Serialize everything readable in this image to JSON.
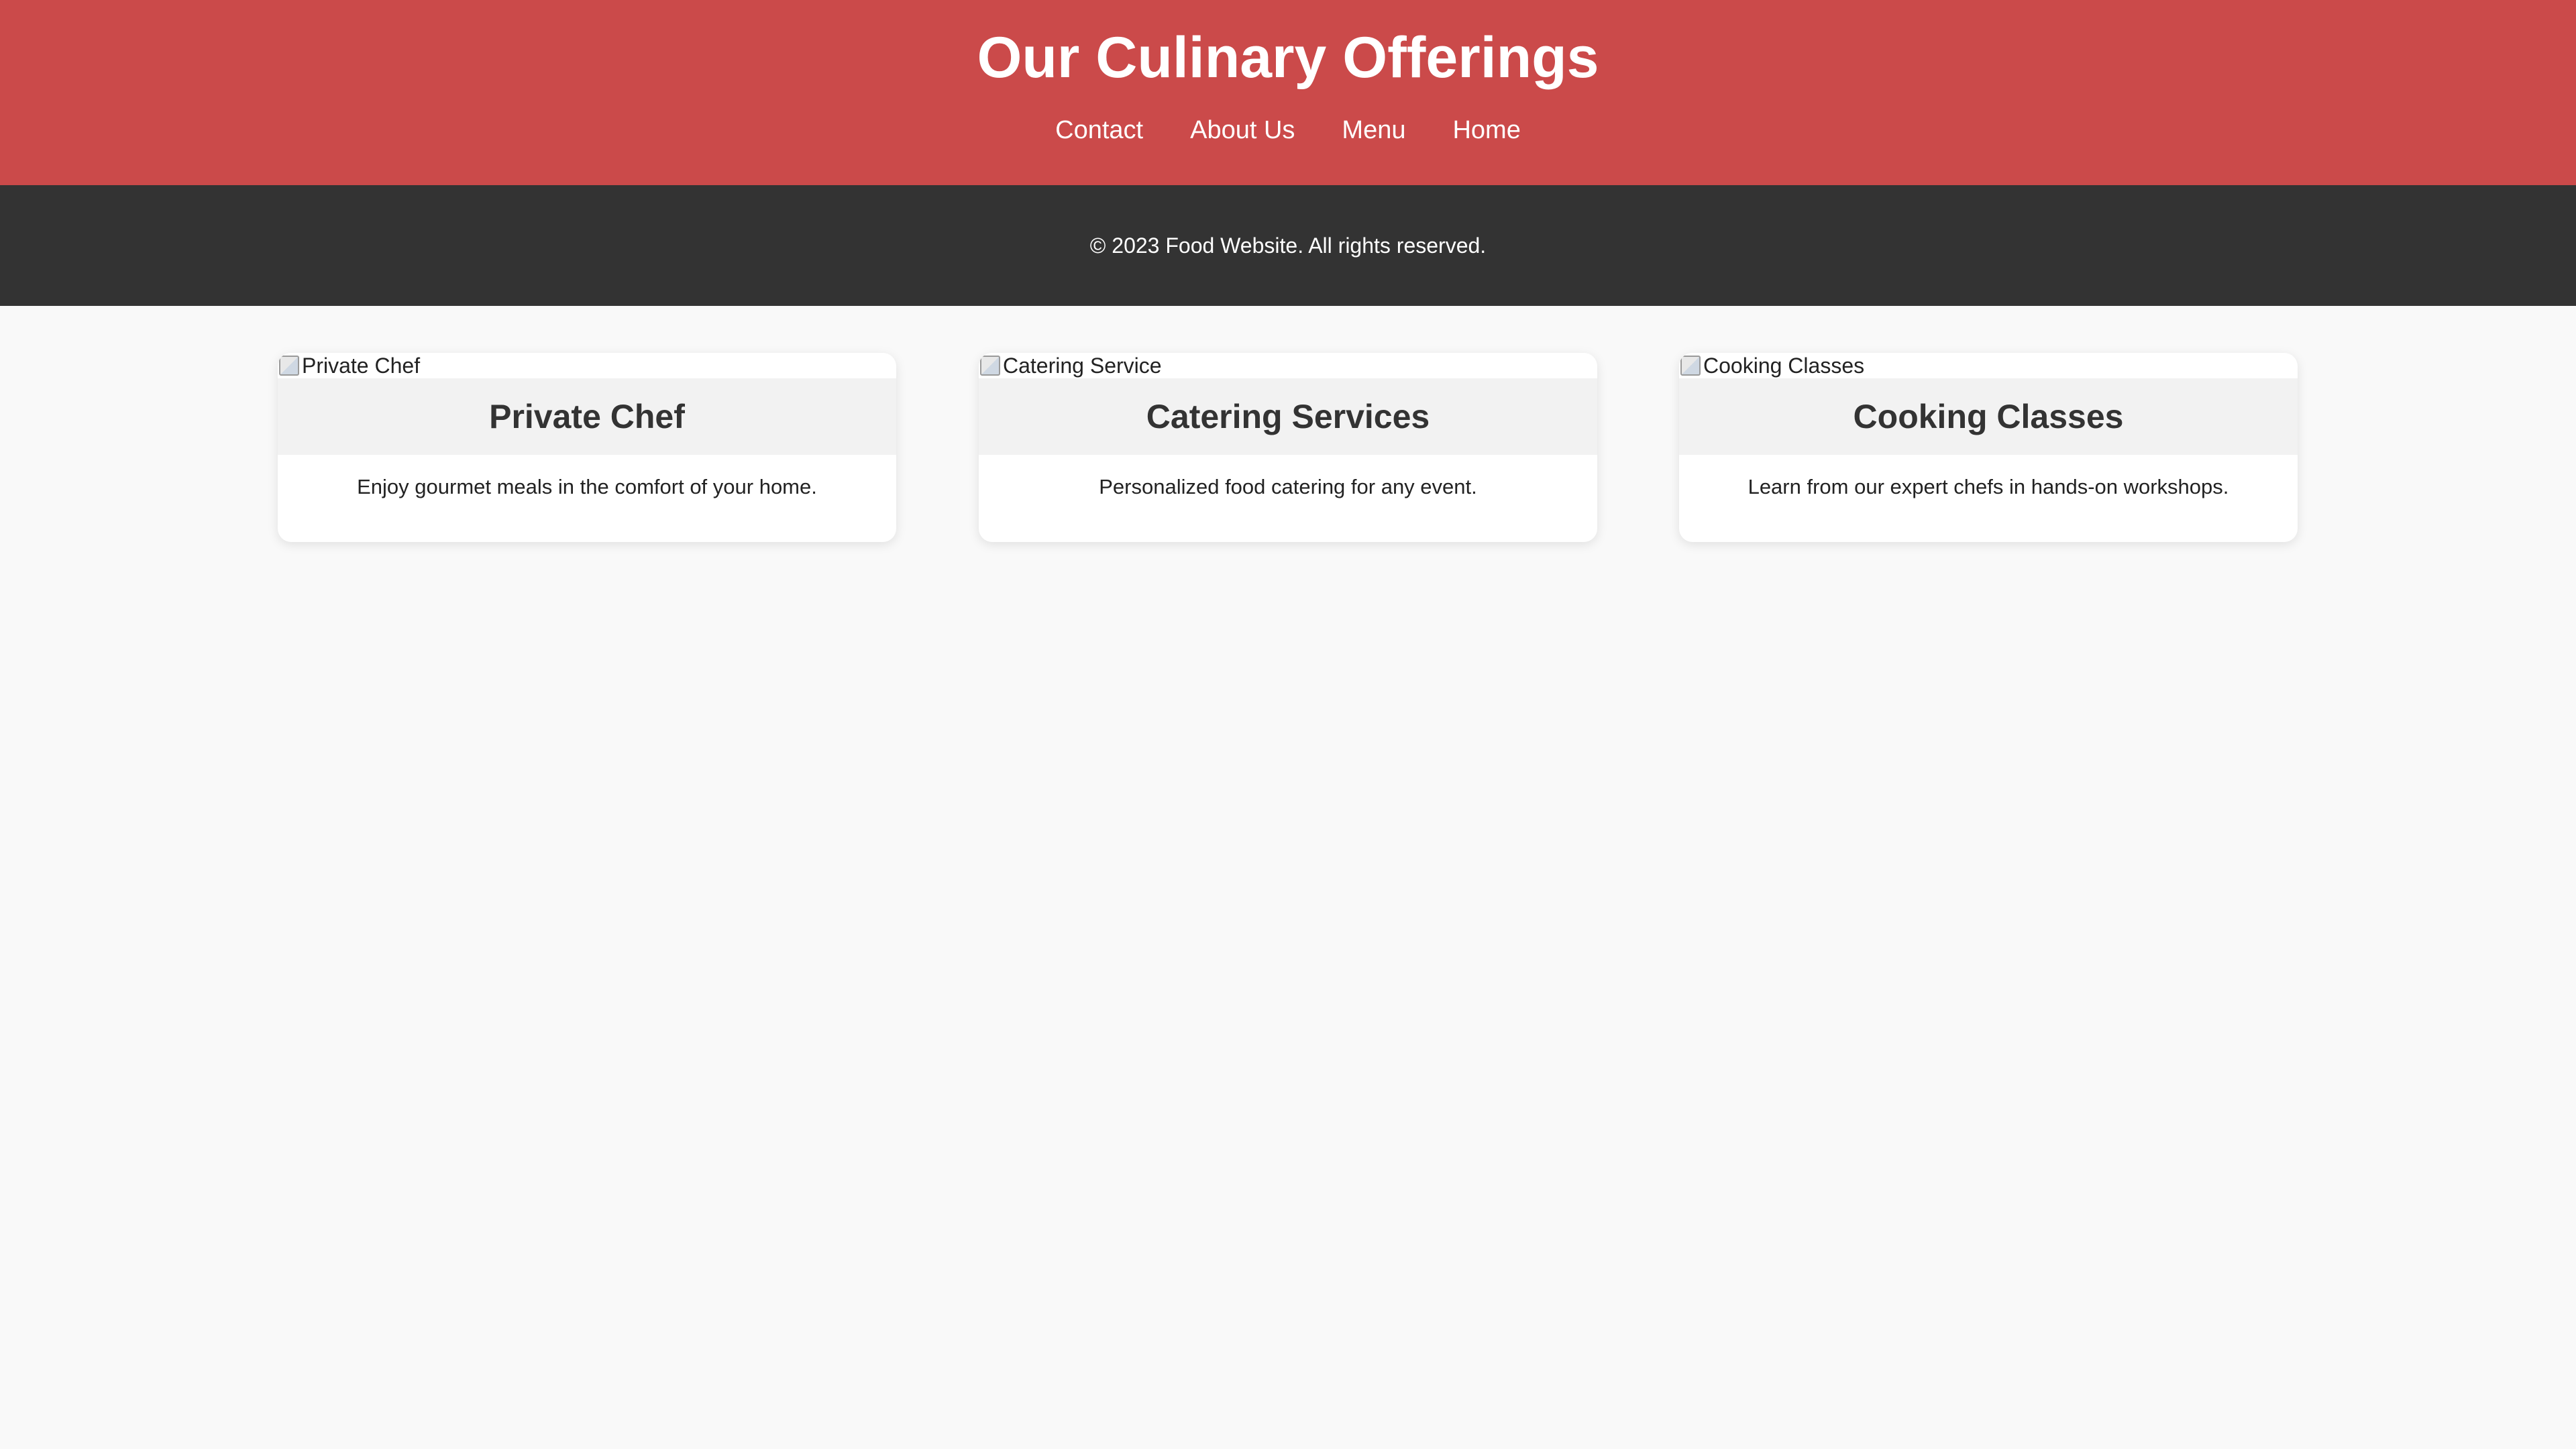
{
  "header": {
    "title": "Our Culinary Offerings",
    "nav": [
      {
        "label": "Contact"
      },
      {
        "label": "About Us"
      },
      {
        "label": "Menu"
      },
      {
        "label": "Home"
      }
    ]
  },
  "footer": {
    "copyright": "© 2023 Food Website. All rights reserved."
  },
  "cards": [
    {
      "image_alt": "Private Chef",
      "title": "Private Chef",
      "description": "Enjoy gourmet meals in the comfort of your home."
    },
    {
      "image_alt": "Catering Service",
      "title": "Catering Services",
      "description": "Personalized food catering for any event."
    },
    {
      "image_alt": "Cooking Classes",
      "title": "Cooking Classes",
      "description": "Learn from our expert chefs in hands-on workshops."
    }
  ],
  "colors": {
    "header_bg": "#cb4a4a",
    "footer_bg": "#333333",
    "page_bg": "#f9f9f9",
    "card_title_bg": "#f2f2f2"
  },
  "icons": {
    "card_image": "broken-image-icon"
  }
}
